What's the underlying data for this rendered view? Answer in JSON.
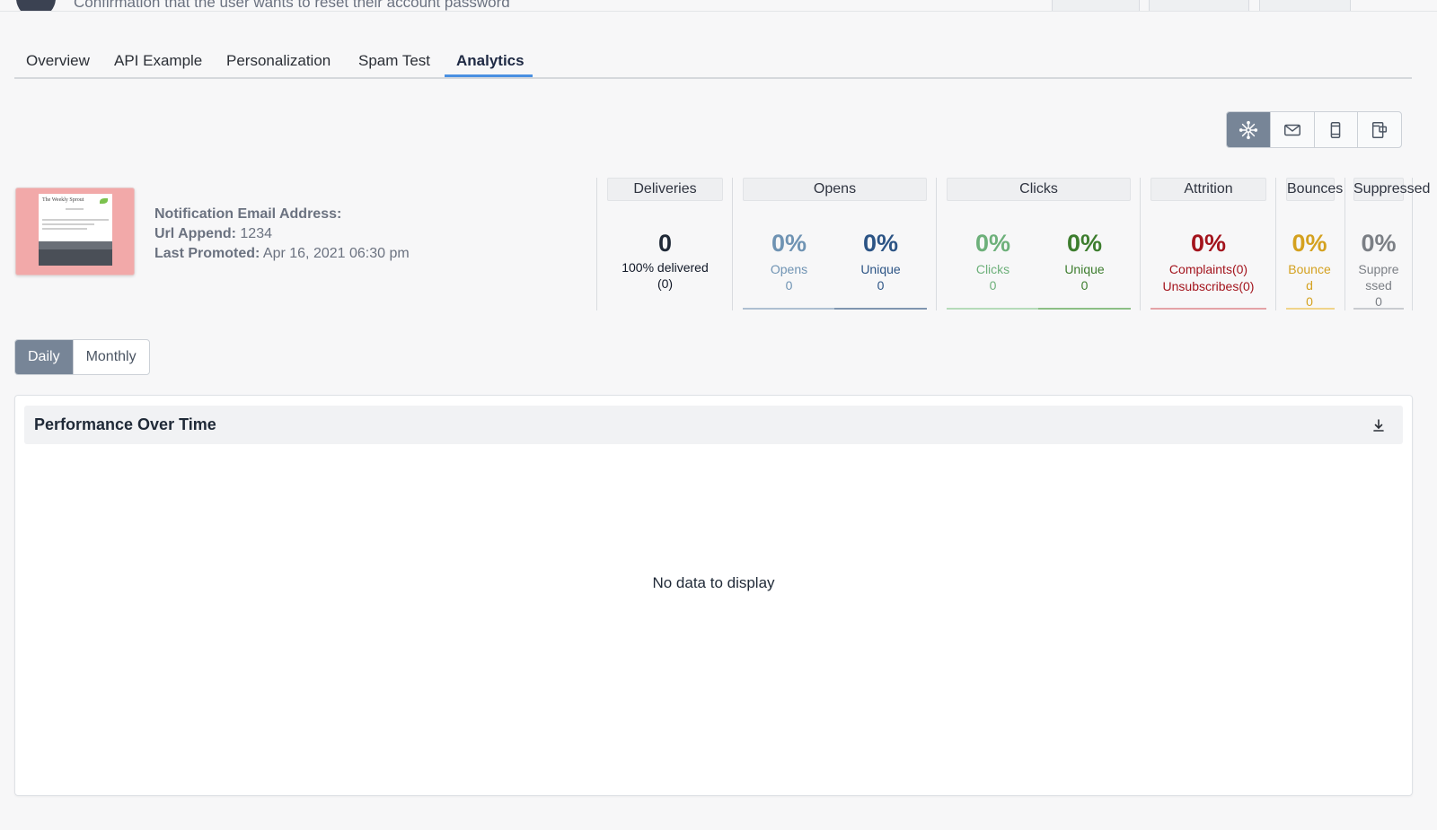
{
  "header": {
    "subtitle": "Confirmation that the user wants to reset their account password"
  },
  "tabs": [
    {
      "label": "Overview"
    },
    {
      "label": "API Example"
    },
    {
      "label": "Personalization"
    },
    {
      "label": "Spam Test"
    },
    {
      "label": "Analytics",
      "active": true
    }
  ],
  "view_toggle": {
    "buttons": [
      {
        "icon": "network-icon",
        "active": true
      },
      {
        "icon": "envelope-icon"
      },
      {
        "icon": "mobile-icon"
      },
      {
        "icon": "desktop-icon"
      }
    ],
    "active_color": "#778597"
  },
  "thumbnail": {
    "title": "The Weekly Sprout"
  },
  "info": {
    "notification_label": "Notification Email Address:",
    "notification_value": "",
    "url_append_label": "Url Append:",
    "url_append_value": "1234",
    "last_promoted_label": "Last Promoted:",
    "last_promoted_value": "Apr 16, 2021 06:30 pm"
  },
  "stats": {
    "deliveries": {
      "header": "Deliveries",
      "value": "0",
      "label": "100% delivered",
      "count": "(0)"
    },
    "opens": {
      "header": "Opens",
      "total": {
        "value": "0%",
        "label": "Opens",
        "count": "0"
      },
      "unique": {
        "value": "0%",
        "label": "Unique",
        "count": "0"
      }
    },
    "clicks": {
      "header": "Clicks",
      "total": {
        "value": "0%",
        "label": "Clicks",
        "count": "0"
      },
      "unique": {
        "value": "0%",
        "label": "Unique",
        "count": "0"
      }
    },
    "attrition": {
      "header": "Attrition",
      "value": "0%",
      "complaints": "Complaints(0)",
      "unsubscribes": "Unsubscribes(0)"
    },
    "bounces": {
      "header": "Bounces",
      "value": "0%",
      "label_1": "Bounce",
      "label_2": "d",
      "count": "0"
    },
    "suppressed": {
      "header": "Suppressed",
      "value": "0%",
      "label_1": "Suppre",
      "label_2": "ssed",
      "count": "0"
    },
    "colors": {
      "opens_light": "#6f93b3",
      "opens_dark": "#2c5485",
      "clicks_light": "#6db07a",
      "clicks_dark": "#3d7d2e",
      "attrition": "#a3141d",
      "bounces": "#d4a11f",
      "suppressed": "#7b7f85"
    }
  },
  "period_toggle": {
    "daily": "Daily",
    "monthly": "Monthly",
    "active": "Daily"
  },
  "panel": {
    "title": "Performance Over Time",
    "empty_message": "No data to display"
  }
}
